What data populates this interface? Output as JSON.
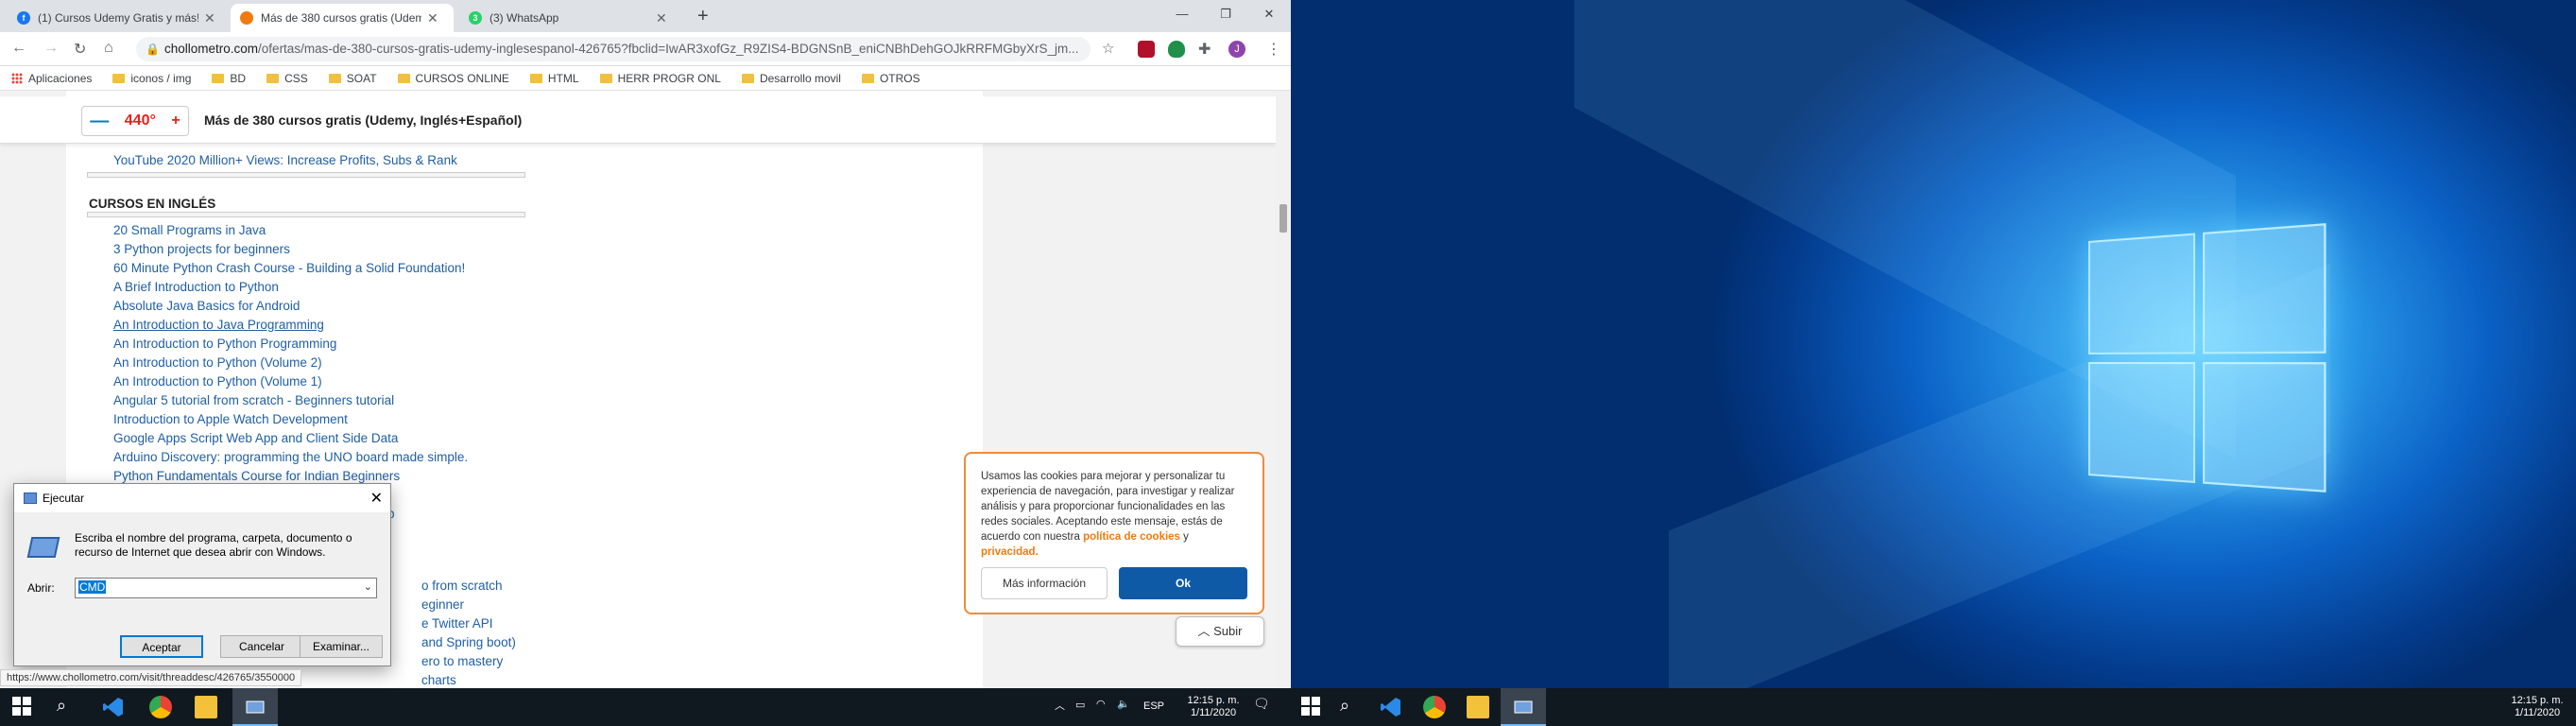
{
  "browser": {
    "tabs": [
      {
        "label": "(1) Cursos Udemy Gratis y más! |",
        "icon_color": "#1877f2",
        "icon_text": "f"
      },
      {
        "label": "Más de 380 cursos gratis (Udem",
        "icon_color": "#f07a10",
        "icon_text": ""
      },
      {
        "label": "(3) WhatsApp",
        "icon_color": "#25d366",
        "icon_text": "3"
      }
    ],
    "url_host": "chollometro.com",
    "url_path": "/ofertas/mas-de-380-cursos-gratis-udemy-inglesespanol-426765?fbclid=IwAR3xofGz_R9ZIS4-BDGNSnB_eniCNBhDehGOJkRRFMGbyXrS_jm...",
    "profile_initial": "J",
    "bookmarks": [
      "Aplicaciones",
      "iconos / img",
      "BD",
      "CSS",
      "SOAT",
      "CURSOS ONLINE",
      "HTML",
      "HERR PROGR ONL",
      "Desarrollo movil",
      "OTROS"
    ]
  },
  "deal": {
    "votes": "440°",
    "minus": "—",
    "plus": "+",
    "title": "Más de 380 cursos gratis (Udemy, Inglés+Español)"
  },
  "article": {
    "top_link": "YouTube 2020 Million+ Views: Increase Profits, Subs & Rank",
    "section_heading": "CURSOS EN INGLÉS",
    "courses": [
      "20 Small Programs in Java",
      "3 Python projects for beginners",
      "60 Minute Python Crash Course - Building a Solid Foundation!",
      "A Brief Introduction to Python",
      "Absolute Java Basics for Android",
      "An Introduction to Java Programming",
      "An Introduction to Python Programming",
      "An Introduction to Python (Volume 2)",
      "An Introduction to Python (Volume 1)",
      "Angular 5 tutorial from scratch - Beginners tutorial",
      "Introduction to Apple Watch Development",
      "Google Apps Script Web App and Client Side Data",
      "Arduino Discovery: programming the UNO board made simple.",
      "Python Fundamentals Course for Indian Beginners"
    ],
    "partial_links": [
      "p",
      "o from scratch",
      "eginner",
      "e Twitter API",
      "and Spring boot)",
      "ero to mastery",
      "charts"
    ]
  },
  "status_url": "https://www.chollometro.com/visit/threaddesc/426765/3550000",
  "cookie": {
    "text": "Usamos las cookies para mejorar y personalizar tu experiencia de navegación, para investigar y realizar análisis y para proporcionar funcionalidades en las redes sociales. Aceptando este mensaje, estás de acuerdo con nuestra",
    "policy_link": "política de cookies",
    "and": "y",
    "privacy_link": "privacidad.",
    "more_button": "Más información",
    "ok_button": "Ok"
  },
  "subir_label": "Subir",
  "run_dialog": {
    "title": "Ejecutar",
    "description": "Escriba el nombre del programa, carpeta, documento o recurso de Internet que desea abrir con Windows.",
    "open_label": "Abrir:",
    "value": "CMD",
    "accept": "Aceptar",
    "cancel": "Cancelar",
    "browse": "Examinar..."
  },
  "taskbar_left": {
    "lang": "ESP",
    "time": "12:15 p. m.",
    "date": "1/11/2020"
  },
  "taskbar_right": {
    "time": "12:15 p. m.",
    "date": "1/11/2020"
  }
}
